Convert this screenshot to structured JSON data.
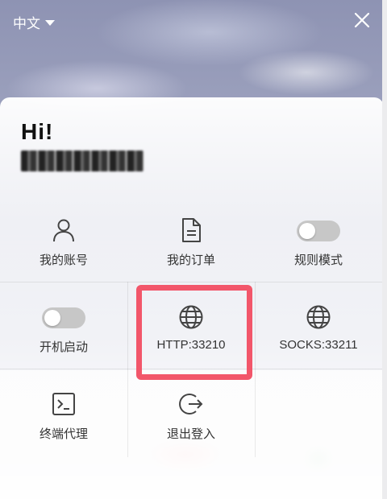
{
  "header": {
    "language": "中文",
    "close_icon": "close-icon"
  },
  "greeting": {
    "hi": "Hi!",
    "account_id": "81********48"
  },
  "grid": {
    "my_account": "我的账号",
    "my_orders": "我的订单",
    "rule_mode": "规则模式",
    "rule_mode_on": false,
    "autostart": "开机启动",
    "autostart_on": false,
    "http": "HTTP:33210",
    "socks": "SOCKS:33211",
    "terminal_proxy": "终端代理",
    "logout": "退出登入"
  },
  "highlight_color": "#f2566a"
}
